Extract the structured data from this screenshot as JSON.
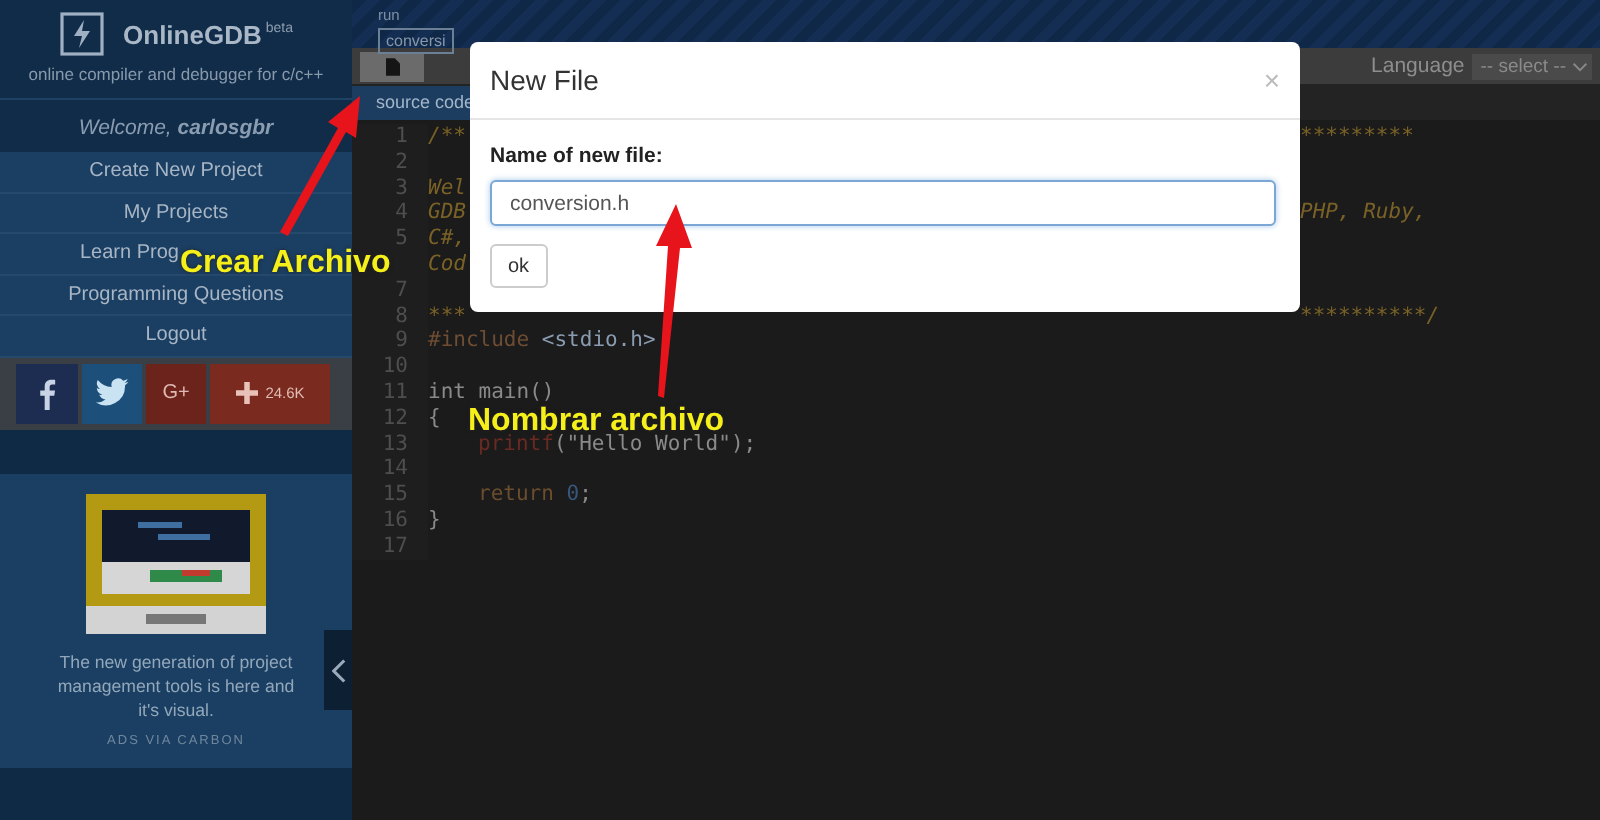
{
  "sidebar": {
    "brand": "OnlineGDB",
    "brand_badge": "beta",
    "tagline": "online compiler and debugger for c/c++",
    "welcome": "Welcome, **carlosgbr**",
    "menu": [
      {
        "label": "Create New Project"
      },
      {
        "label": "My Projects"
      },
      {
        "label": "Learn Prog",
        "cut": true
      },
      {
        "label": "Programming Questions"
      },
      {
        "label": "Logout"
      }
    ],
    "social": [
      {
        "kind": "facebook"
      },
      {
        "kind": "twitter"
      },
      {
        "kind": "googleplus",
        "label": "G+"
      },
      {
        "kind": "share",
        "label": "24.6K"
      }
    ],
    "ad": {
      "text": "The new generation of project management tools is here and it's visual.",
      "footer": "ADS VIA CARBON"
    }
  },
  "header": {
    "label": "run",
    "file_field": "conversi",
    "language_label": "Language",
    "language_select": "-- select --"
  },
  "tab": "source code",
  "code_lines": [
    {
      "number": "1",
      "tokens": [
        {
          "kind": "comment",
          "text": "/**"
        }
      ],
      "tail": [
        {
          "kind": "comment",
          "text": "*********"
        }
      ]
    },
    {
      "number": "2"
    },
    {
      "number": "3",
      "tokens": [
        {
          "kind": "comment",
          "text": "Wel"
        }
      ]
    },
    {
      "number": "4",
      "tokens": [
        {
          "kind": "comment",
          "text": "GDB"
        }
      ],
      "tail": [
        {
          "kind": "comment",
          "text": "PHP, Ruby,"
        }
      ]
    },
    {
      "number": "5",
      "tokens": [
        {
          "kind": "comment",
          "text": "C#,"
        }
      ]
    },
    {
      "tokens": [
        {
          "kind": "comment",
          "text": "Cod"
        }
      ]
    },
    {
      "number": "7"
    },
    {
      "number": "8",
      "tokens": [
        {
          "kind": "comment",
          "text": "***"
        }
      ],
      "tail": [
        {
          "kind": "comment",
          "text": "**********/"
        }
      ]
    },
    {
      "number": "9",
      "tokens": [
        {
          "kind": "directive",
          "text": "#include "
        },
        {
          "kind": "header",
          "text": "<stdio.h>"
        }
      ]
    },
    {
      "number": "10"
    },
    {
      "number": "11",
      "tokens": [
        {
          "kind": "plain",
          "text": "int main()"
        }
      ]
    },
    {
      "number": "12",
      "tokens": [
        {
          "kind": "plain",
          "text": "{"
        }
      ]
    },
    {
      "number": "13",
      "indented": true,
      "tokens": [
        {
          "kind": "function",
          "text": "printf"
        },
        {
          "kind": "plain",
          "text": "(\"Hello World\");"
        }
      ]
    },
    {
      "number": "14"
    },
    {
      "number": "15",
      "indented": true,
      "tokens": [
        {
          "kind": "keyword",
          "text": "return"
        },
        {
          "kind": "number",
          "text": " 0"
        },
        {
          "kind": "plain",
          "text": ";"
        }
      ]
    },
    {
      "number": "16",
      "tokens": [
        {
          "kind": "plain",
          "text": "}"
        }
      ]
    },
    {
      "number": "17"
    }
  ],
  "dialog": {
    "title": "New File",
    "close": "×",
    "field_label": "Name of new file:",
    "field_value": "conversion.h",
    "ok": "ok"
  },
  "annotations": [
    {
      "text": "Crear Archivo"
    },
    {
      "text": "Nombrar archivo"
    }
  ]
}
